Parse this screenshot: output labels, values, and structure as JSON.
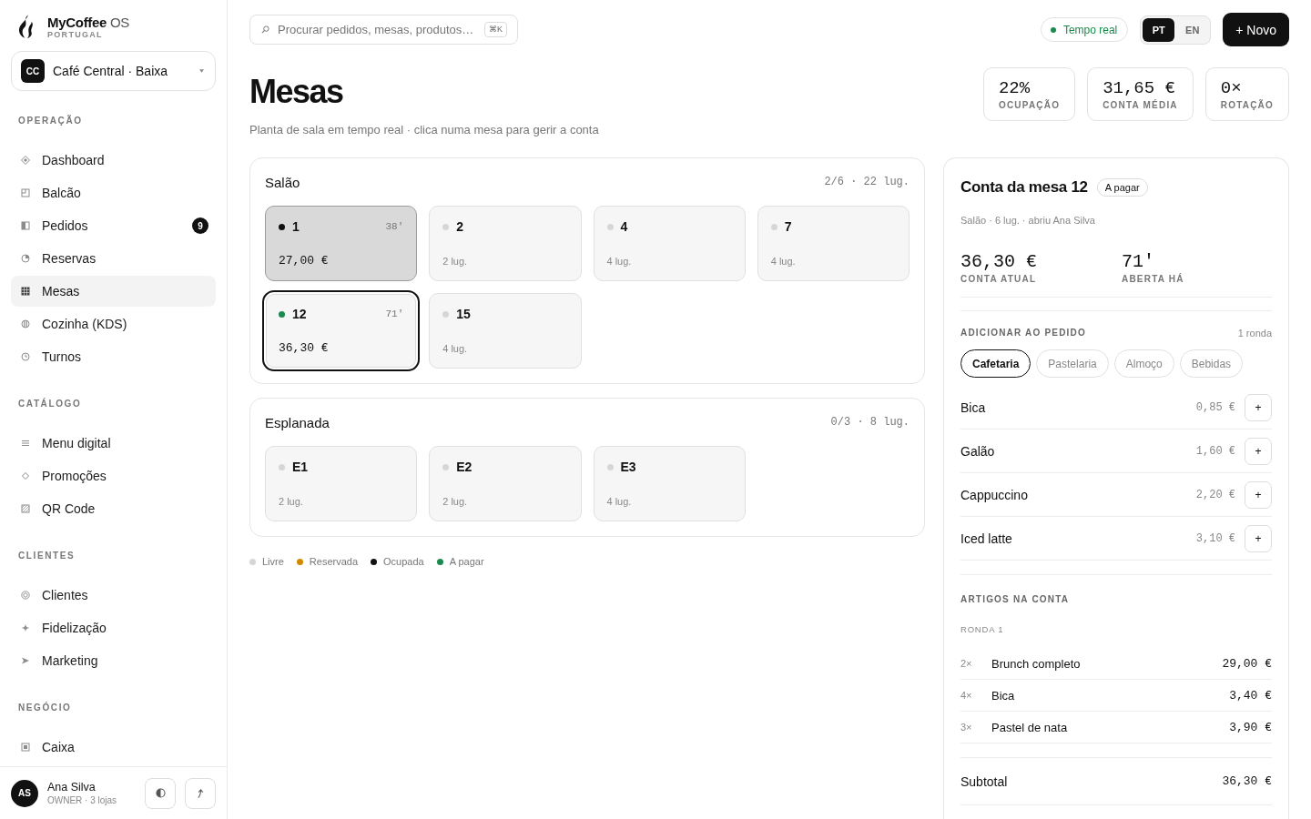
{
  "sidebar": {
    "brand": {
      "name": "**MyCoffee** OS",
      "region": "PORTUGAL"
    },
    "store": {
      "initials": "CC",
      "name": "Café Central · Baixa"
    },
    "sections": [
      {
        "title": "OPERAÇÃO",
        "items": [
          {
            "label": "Dashboard",
            "selected": false
          },
          {
            "label": "Balcão",
            "selected": false
          },
          {
            "label": "Pedidos",
            "selected": false,
            "badge": "9"
          },
          {
            "label": "Reservas",
            "selected": false
          },
          {
            "label": "Mesas",
            "selected": true
          },
          {
            "label": "Cozinha (KDS)",
            "selected": false
          },
          {
            "label": "Turnos",
            "selected": false
          }
        ]
      },
      {
        "title": "CATÁLOGO",
        "items": [
          {
            "label": "Menu digital",
            "selected": false
          },
          {
            "label": "Promoções",
            "selected": false
          },
          {
            "label": "QR Code",
            "selected": false
          }
        ]
      },
      {
        "title": "CLIENTES",
        "items": [
          {
            "label": "Clientes",
            "selected": false
          },
          {
            "label": "Fidelização",
            "selected": false
          },
          {
            "label": "Marketing",
            "selected": false
          }
        ]
      },
      {
        "title": "NEGÓCIO",
        "items": [
          {
            "label": "Caixa",
            "selected": false
          }
        ]
      }
    ],
    "user": {
      "initials": "AS",
      "name": "Ana Silva",
      "role": "OWNER · 3 lojas"
    }
  },
  "topbar": {
    "search": {
      "placeholder": "Procurar pedidos, mesas, produtos…",
      "shortcut": "⌘K"
    },
    "live": "Tempo real",
    "languages": [
      {
        "label": "PT",
        "selected": true
      },
      {
        "label": "EN",
        "selected": false
      }
    ],
    "new_button": "+ Novo"
  },
  "header": {
    "title": "Mesas",
    "subtitle": "Planta de sala em tempo real · clica numa mesa para gerir a conta",
    "stats": [
      {
        "value": "22%",
        "label": "OCUPAÇÃO"
      },
      {
        "value": "31,65 €",
        "label": "CONTA MÉDIA"
      },
      {
        "value": "0×",
        "label": "ROTAÇÃO"
      }
    ]
  },
  "areas": [
    {
      "name": "Salão",
      "summary": "2/6 · 22 lug.",
      "tables": [
        {
          "number": "1",
          "kind": "occupied",
          "color": "#111111",
          "time": "38′",
          "amount": "27,00 €",
          "selected": false
        },
        {
          "number": "2",
          "kind": "free",
          "color": "#d6d6d6",
          "seats": "2 lug.",
          "selected": false
        },
        {
          "number": "4",
          "kind": "free",
          "color": "#d6d6d6",
          "seats": "4 lug.",
          "selected": false
        },
        {
          "number": "7",
          "kind": "free",
          "color": "#d6d6d6",
          "seats": "4 lug.",
          "selected": false
        },
        {
          "number": "12",
          "kind": "paying",
          "color": "#1a8a4f",
          "time": "71′",
          "amount": "36,30 €",
          "selected": true
        },
        {
          "number": "15",
          "kind": "free",
          "color": "#d6d6d6",
          "seats": "4 lug.",
          "selected": false
        }
      ]
    },
    {
      "name": "Esplanada",
      "summary": "0/3 · 8 lug.",
      "tables": [
        {
          "number": "E1",
          "kind": "free",
          "color": "#d6d6d6",
          "seats": "2 lug.",
          "selected": false
        },
        {
          "number": "E2",
          "kind": "free",
          "color": "#d6d6d6",
          "seats": "2 lug.",
          "selected": false
        },
        {
          "number": "E3",
          "kind": "free",
          "color": "#d6d6d6",
          "seats": "4 lug.",
          "selected": false
        }
      ]
    }
  ],
  "legend": [
    {
      "label": "Livre",
      "color": "#d6d6d6"
    },
    {
      "label": "Reservada",
      "color": "#d18a00"
    },
    {
      "label": "Ocupada",
      "color": "#111111"
    },
    {
      "label": "A pagar",
      "color": "#1a8a4f"
    }
  ],
  "bill": {
    "title": "Conta da mesa 12",
    "badge": "A pagar",
    "meta": "Salão · 6 lug. · abriu Ana Silva",
    "stats": [
      {
        "value": "36,30 €",
        "label": "CONTA ATUAL"
      },
      {
        "value": "71′",
        "label": "ABERTA HÁ"
      }
    ],
    "add": {
      "title": "ADICIONAR AO PEDIDO",
      "rounds": "1 ronda",
      "categories": [
        {
          "label": "Cafetaria",
          "selected": true
        },
        {
          "label": "Pastelaria",
          "selected": false
        },
        {
          "label": "Almoço",
          "selected": false
        },
        {
          "label": "Bebidas",
          "selected": false
        }
      ],
      "products": [
        {
          "name": "Bica",
          "price": "0,85 €",
          "button": "+"
        },
        {
          "name": "Galão",
          "price": "1,60 €",
          "button": "+"
        },
        {
          "name": "Cappuccino",
          "price": "2,20 €",
          "button": "+"
        },
        {
          "name": "Iced latte",
          "price": "3,10 €",
          "button": "+"
        }
      ]
    },
    "items": {
      "title": "ARTIGOS NA CONTA",
      "rounds": [
        {
          "title": "RONDA 1",
          "lines": [
            {
              "quantity": "2×",
              "name": "Brunch completo",
              "price": "29,00 €"
            },
            {
              "quantity": "4×",
              "name": "Bica",
              "price": "3,40 €"
            },
            {
              "quantity": "3×",
              "name": "Pastel de nata",
              "price": "3,90 €"
            }
          ]
        }
      ]
    },
    "subtotal": {
      "label": "Subtotal",
      "value": "36,30 €"
    }
  }
}
